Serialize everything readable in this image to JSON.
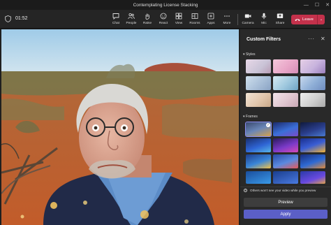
{
  "window": {
    "title": "Contemplating License Stacking"
  },
  "toolbar": {
    "timer": "01:52",
    "buttons": [
      {
        "label": "Chat",
        "icon": "chat-icon"
      },
      {
        "label": "People",
        "icon": "people-icon"
      },
      {
        "label": "Raise",
        "icon": "raise-hand-icon"
      },
      {
        "label": "React",
        "icon": "react-icon"
      },
      {
        "label": "View",
        "icon": "view-icon"
      },
      {
        "label": "Rooms",
        "icon": "rooms-icon"
      },
      {
        "label": "Apps",
        "icon": "apps-icon"
      },
      {
        "label": "More",
        "icon": "more-icon"
      },
      {
        "label": "Camera",
        "icon": "camera-icon"
      },
      {
        "label": "Mic",
        "icon": "mic-icon"
      },
      {
        "label": "Share",
        "icon": "share-icon"
      }
    ],
    "leave_label": "Leave"
  },
  "panel": {
    "title": "Custom Filters",
    "styles_label": "Styles",
    "frames_label": "Frames",
    "notice": "Others won't see your video while you preview",
    "preview_label": "Preview",
    "apply_label": "Apply"
  },
  "colors": {
    "leave": "#c4314b",
    "apply": "#5b5fc7",
    "panel": "#292929"
  }
}
